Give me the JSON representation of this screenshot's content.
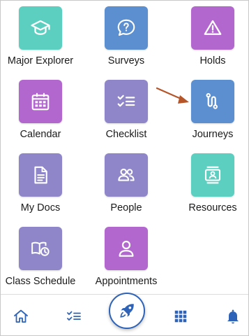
{
  "apps": [
    {
      "label": "Major Explorer",
      "icon": "graduation-cap-icon",
      "color": "#5ccfc1"
    },
    {
      "label": "Surveys",
      "icon": "question-bubble-icon",
      "color": "#5b8fcf"
    },
    {
      "label": "Holds",
      "icon": "warning-triangle-icon",
      "color": "#b267cf"
    },
    {
      "label": "Calendar",
      "icon": "calendar-icon",
      "color": "#b267cf"
    },
    {
      "label": "Checklist",
      "icon": "checklist-icon",
      "color": "#8e86c8"
    },
    {
      "label": "Journeys",
      "icon": "route-icon",
      "color": "#5b8fcf"
    },
    {
      "label": "My Docs",
      "icon": "document-icon",
      "color": "#8e86c8"
    },
    {
      "label": "People",
      "icon": "people-icon",
      "color": "#8e86c8"
    },
    {
      "label": "Resources",
      "icon": "id-card-icon",
      "color": "#5ccfc1"
    },
    {
      "label": "Class Schedule",
      "icon": "book-clock-icon",
      "color": "#8e86c8"
    },
    {
      "label": "Appointments",
      "icon": "person-icon",
      "color": "#b267cf"
    }
  ],
  "annotation": {
    "arrow_color": "#b5562a",
    "points_to": "Journeys"
  },
  "bottom_nav": {
    "items": [
      "home-icon",
      "checklist-icon",
      "rocket-icon",
      "grid-icon",
      "bell-icon"
    ],
    "accent": "#2e63b8"
  }
}
